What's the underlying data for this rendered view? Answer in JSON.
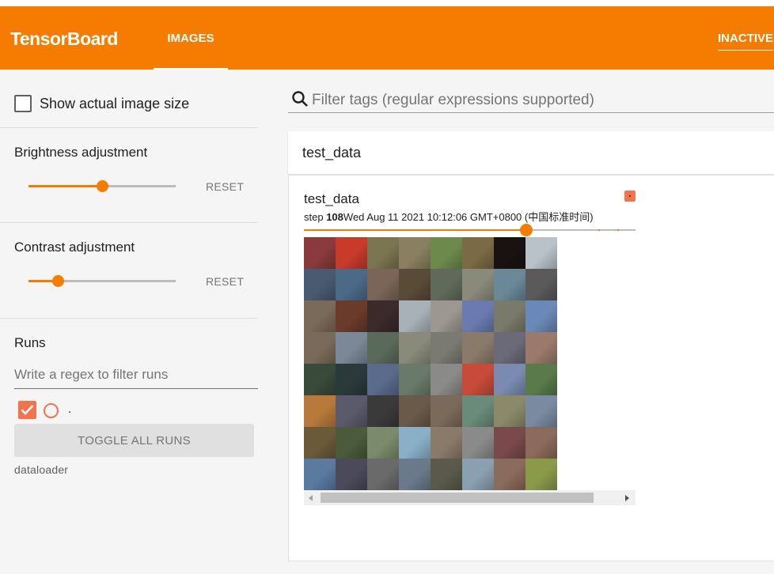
{
  "header": {
    "brand": "TensorBoard",
    "active_tab": "IMAGES",
    "inactive_tab": "INACTIVE",
    "color": "#f57c00"
  },
  "sidebar": {
    "show_actual_size": {
      "label": "Show actual image size",
      "checked": false
    },
    "brightness": {
      "title": "Brightness adjustment",
      "value_fraction": 0.5,
      "reset_label": "RESET"
    },
    "contrast": {
      "title": "Contrast adjustment",
      "value_fraction": 0.2,
      "reset_label": "RESET"
    },
    "runs": {
      "title": "Runs",
      "regex_placeholder": "Write a regex to filter runs",
      "items": [
        {
          "label": ".",
          "checked": true,
          "color": "#f4734d"
        }
      ],
      "toggle_all_label": "TOGGLE ALL RUNS",
      "footer": "dataloader"
    }
  },
  "main": {
    "filter_placeholder": "Filter tags (regular expressions supported)",
    "tag_group": "test_data",
    "card": {
      "title": "test_data",
      "step_label": "step",
      "step_value": "108",
      "timestamp": "Wed Aug 11 2021 10:12:06 GMT+0800 (中国标准时间)",
      "step_fraction": 0.67,
      "run_color": "#f4734d"
    }
  },
  "image_grid_colors": [
    [
      "#8a3a3a",
      "#c83a2a",
      "#7a7450",
      "#8a7f60",
      "#6d8a4c",
      "#7a6a45",
      "#1a1210",
      "#b8c2c8"
    ],
    [
      "#4a5a70",
      "#4a6a88",
      "#7a6658",
      "#5a4a38",
      "#606a5a",
      "#8a8a7a",
      "#6a8898",
      "#5a5a5a"
    ],
    [
      "#7a6a58",
      "#6a3a2a",
      "#3a2a2a",
      "#a8b0b8",
      "#9a9890",
      "#6a7ab0",
      "#7a7a6a",
      "#6a88b8"
    ],
    [
      "#7a6a5a",
      "#7a8898",
      "#5a6a5a",
      "#8a8a7a",
      "#7a7a72",
      "#8a7a6a",
      "#6a6a78",
      "#9a7a6a"
    ],
    [
      "#3a4a3a",
      "#2a3a3a",
      "#5a6a8a",
      "#6a7a6a",
      "#8a8a88",
      "#c84a3a",
      "#7a8ab0",
      "#5a7a4a"
    ],
    [
      "#b87a3a",
      "#5a5a6a",
      "#3a3a3a",
      "#6a5a4a",
      "#7a6a5a",
      "#6a8a7a",
      "#8a8a6a",
      "#7a8aa0"
    ],
    [
      "#6a5a3a",
      "#4a5a3a",
      "#7a8a6a",
      "#8ab0c8",
      "#8a7a6a",
      "#8a8a8a",
      "#7a4a4a",
      "#8a6a5a"
    ],
    [
      "#5a7aa0",
      "#4a4a5a",
      "#6a6a6a",
      "#6a7a8a",
      "#5a5a4a",
      "#8aa0b0",
      "#8a6a5a",
      "#8a9a4a"
    ]
  ]
}
